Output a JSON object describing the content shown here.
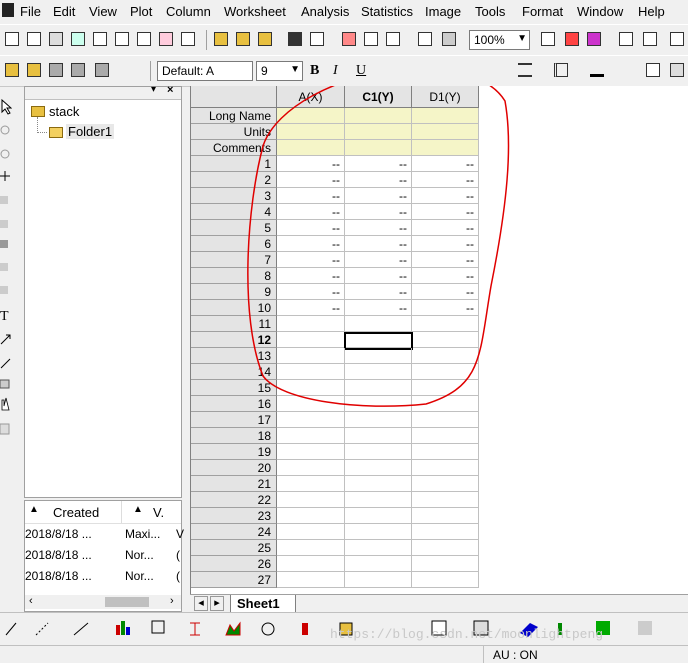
{
  "menu": [
    "File",
    "Edit",
    "View",
    "Plot",
    "Column",
    "Worksheet",
    "Analysis",
    "Statistics",
    "Image",
    "Tools",
    "Format",
    "Window",
    "Help"
  ],
  "toolbar": {
    "zoom": "100%",
    "font": "Default: A",
    "font_size": "9",
    "bold": "B",
    "italic": "I",
    "underline": "U"
  },
  "explorer": {
    "root": "stack",
    "folder": "Folder1",
    "columns": [
      "Created",
      "V."
    ],
    "rows": [
      {
        "created": "2018/8/18 ...",
        "view": "Maxi...",
        "extra": "V"
      },
      {
        "created": "2018/8/18 ...",
        "view": "Nor...",
        "extra": "("
      },
      {
        "created": "2018/8/18 ...",
        "view": "Nor...",
        "extra": "("
      }
    ]
  },
  "worksheet": {
    "columns": [
      "A(X)",
      "C1(Y)",
      "D1(Y)"
    ],
    "label_rows": [
      "Long Name",
      "Units",
      "Comments"
    ],
    "row_numbers": [
      "1",
      "2",
      "3",
      "4",
      "5",
      "6",
      "7",
      "8",
      "9",
      "10",
      "11",
      "12",
      "13",
      "14",
      "15",
      "16",
      "17",
      "18",
      "19",
      "20",
      "21",
      "22",
      "23",
      "24",
      "25",
      "26",
      "27"
    ],
    "filled_value": "--",
    "filled_rows": 10,
    "active_row": "12",
    "sheet_tab": "Sheet1"
  },
  "status": {
    "au": "AU : ON",
    "watermark": "https://blog.csdn.net/moonlightpeng"
  },
  "colors": {
    "label_fill": "#f5f5c8",
    "annotation": "#e00000",
    "header_fill": "#e4e4e4"
  }
}
